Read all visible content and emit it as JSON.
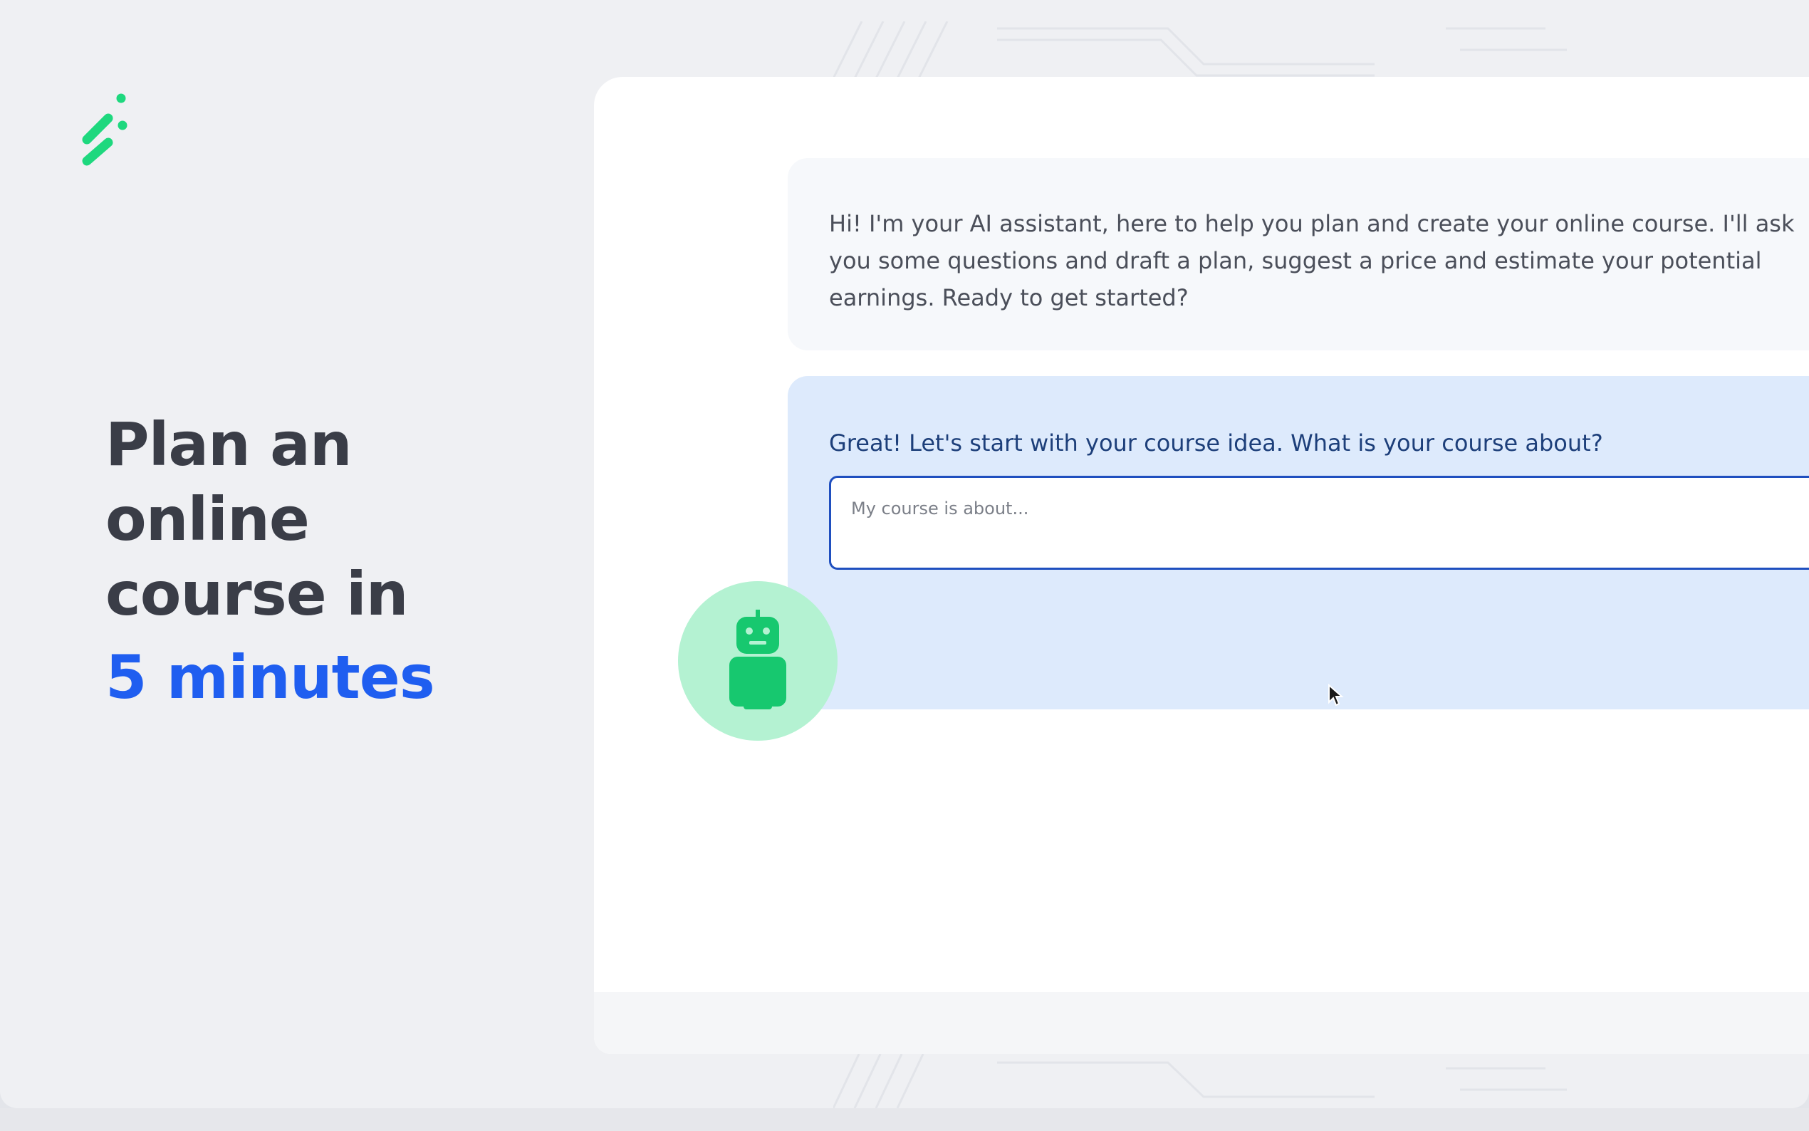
{
  "brand": {
    "logo_icon": "spark-slash-logo",
    "accent_color": "#1f5ef0",
    "logo_color": "#1ed87e"
  },
  "hero": {
    "headline_lines": [
      "Plan an",
      "online",
      "course in"
    ],
    "headline_accent": "5 minutes"
  },
  "chat": {
    "assistant_intro": "Hi! I'm your AI assistant, here to help you plan and create your online course. I'll ask you some questions and draft a plan, suggest a price and estimate your potential earnings. Ready to get started?",
    "question": "Great! Let's start with your course idea. What is your course about?",
    "answer_placeholder": "My course is about...",
    "answer_value": "",
    "avatar_icon": "robot-icon",
    "avatar_color": "#b4f2d2",
    "robot_color": "#17c86f"
  },
  "footer": {
    "left_text": "",
    "center_text": "",
    "right_text": ""
  }
}
